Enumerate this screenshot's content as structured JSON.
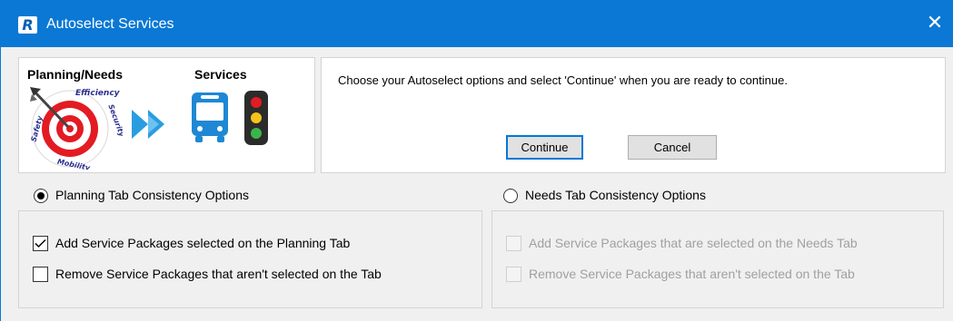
{
  "window": {
    "title": "Autoselect Services",
    "app_icon_letter": "R",
    "close_glyph": "✕"
  },
  "logo": {
    "left_label": "Planning/Needs",
    "right_label": "Services",
    "target_ring_words": [
      "Efficiency",
      "Security",
      "Mobility",
      "Safety"
    ],
    "icons": [
      "target-icon",
      "dart-icon",
      "double-arrow-icon",
      "bus-icon",
      "traffic-light-icon"
    ]
  },
  "message": {
    "text": "Choose your Autoselect options and select 'Continue' when you are ready to continue.",
    "continue_label": "Continue",
    "cancel_label": "Cancel"
  },
  "planning": {
    "label": "Planning Tab Consistency Options",
    "selected": true,
    "options": [
      {
        "label": "Add Service Packages selected on the Planning Tab",
        "checked": true,
        "enabled": true
      },
      {
        "label": "Remove Service Packages that aren't selected on the Tab",
        "checked": false,
        "enabled": true
      }
    ]
  },
  "needs": {
    "label": "Needs Tab Consistency Options",
    "selected": false,
    "options": [
      {
        "label": "Add Service Packages that are selected on the Needs Tab",
        "checked": false,
        "enabled": false
      },
      {
        "label": "Remove Service Packages that aren't selected on the Tab",
        "checked": false,
        "enabled": false
      }
    ]
  },
  "colors": {
    "titlebar": "#0a78d4",
    "accent": "#0078d7",
    "target_red": "#e31b23",
    "arrow_blue": "#2a9de0",
    "bus_blue": "#1e88d4"
  }
}
